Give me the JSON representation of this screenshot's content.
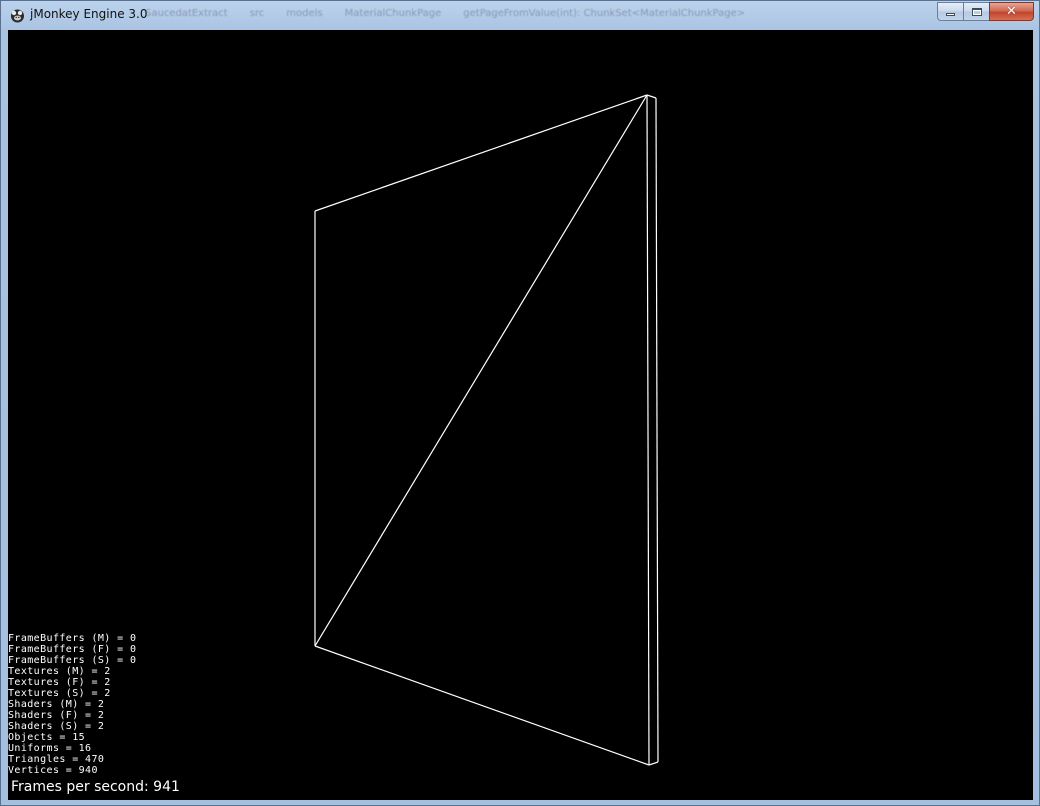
{
  "window": {
    "title": "jMonkey Engine 3.0",
    "background_tabs": [
      "SaucedatExtract",
      "src",
      "models",
      "MaterialChunkPage",
      "getPageFromValue(int): ChunkSet<MaterialChunkPage>"
    ]
  },
  "caption_buttons": {
    "minimize_icon": "minimize-icon",
    "maximize_icon": "maximize-icon",
    "close_glyph": "✕"
  },
  "scene": {
    "background": "#000000",
    "wire_color": "#ffffff",
    "shape": "wireframe-quad"
  },
  "stats": {
    "lines": [
      "FrameBuffers (M) = 0",
      "FrameBuffers (F) = 0",
      "FrameBuffers (S) = 0",
      "Textures (M) = 2",
      "Textures (F) = 2",
      "Textures (S) = 2",
      "Shaders (M) = 2",
      "Shaders (F) = 2",
      "Shaders (S) = 2",
      "Objects = 15",
      "Uniforms = 16",
      "Triangles = 470",
      "Vertices = 940"
    ],
    "fps_text": "Frames per second: 941"
  }
}
